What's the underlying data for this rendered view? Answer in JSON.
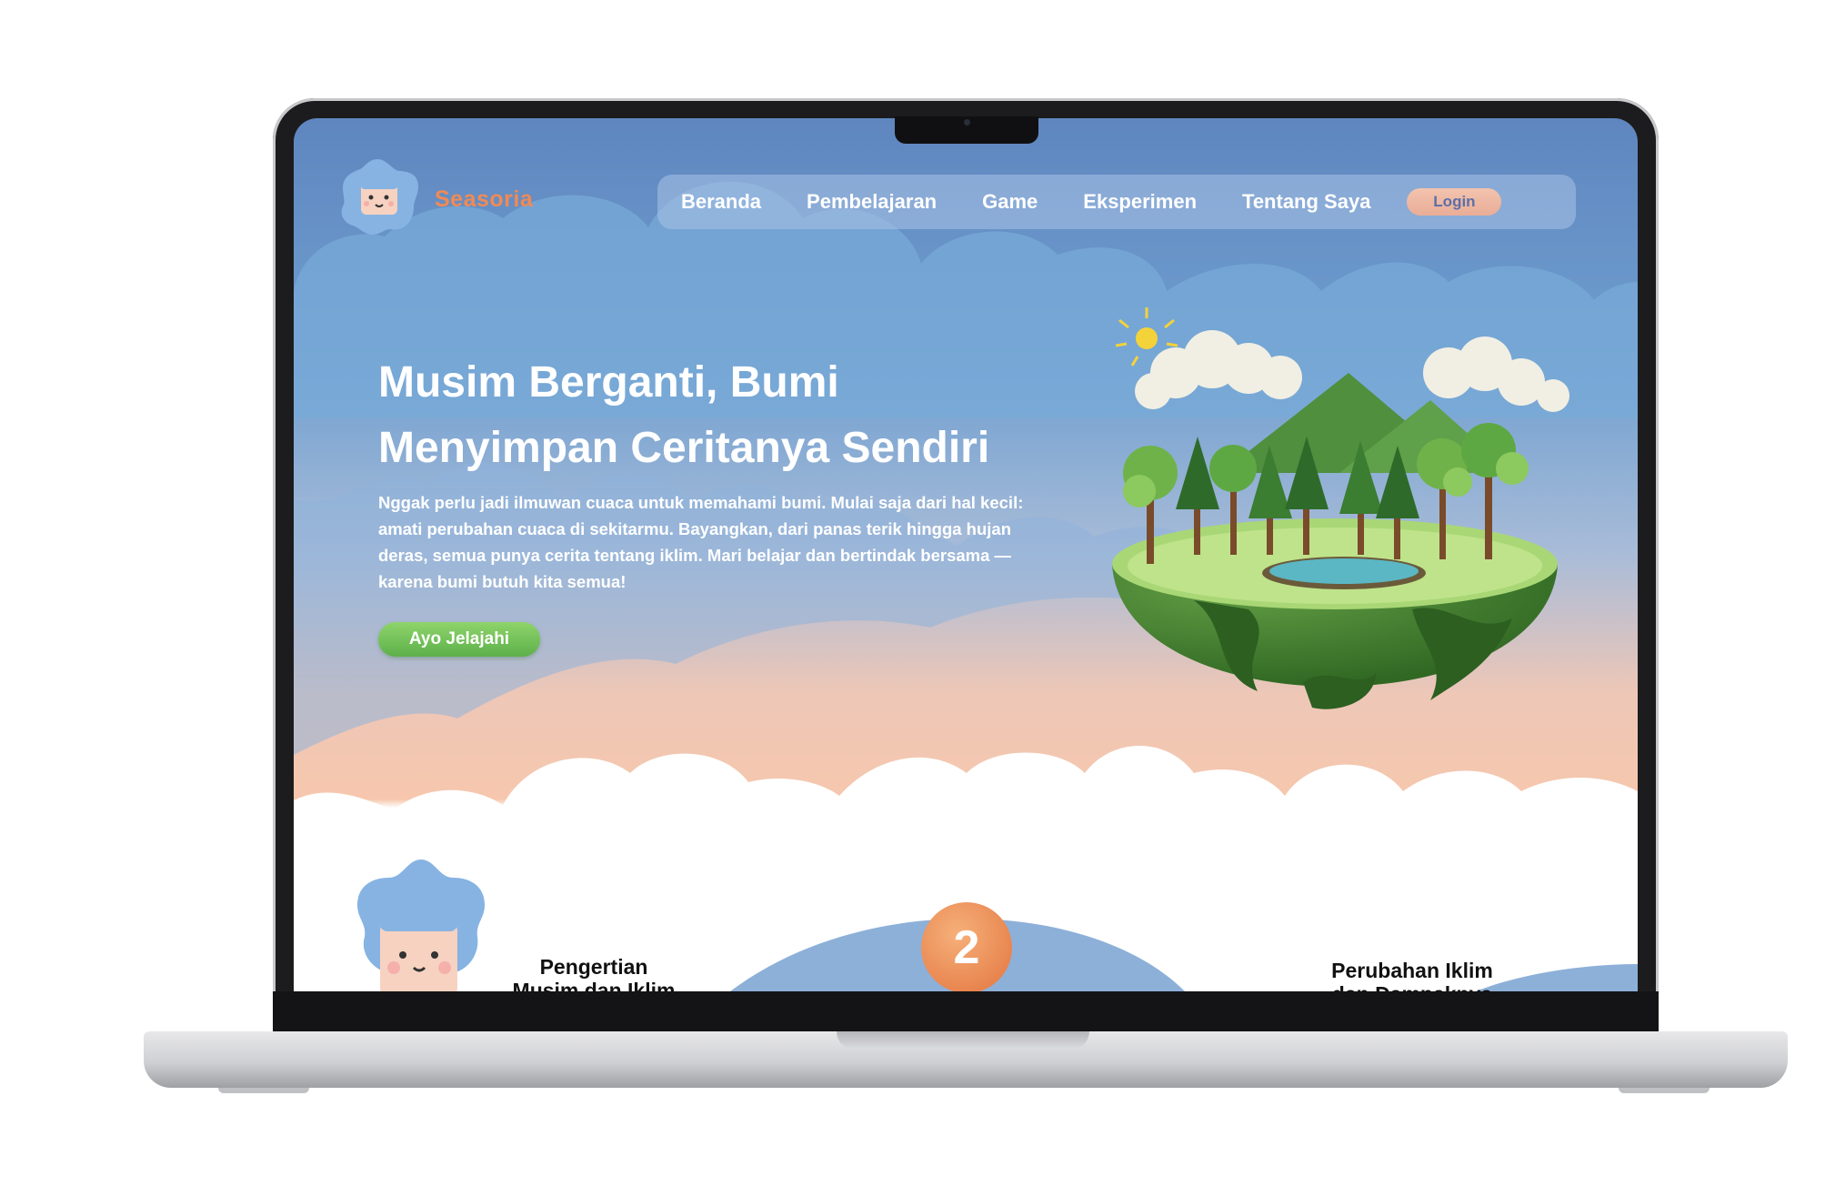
{
  "brand": {
    "name": "Seasoria"
  },
  "nav": {
    "items": [
      "Beranda",
      "Pembelajaran",
      "Game",
      "Eksperimen",
      "Tentang Saya"
    ],
    "login_label": "Login"
  },
  "hero": {
    "title_line1": "Musim Berganti, Bumi",
    "title_line2": "Menyimpan Ceritanya Sendiri",
    "text": "Nggak perlu jadi ilmuwan cuaca untuk memahami bumi. Mulai saja dari hal kecil: amati perubahan cuaca di sekitarmu. Bayangkan, dari panas terik hingga hujan deras, semua punya cerita tentang iklim. Mari belajar dan bertindak bersama — karena bumi butuh kita semua!",
    "cta_label": "Ayo Jelajahi"
  },
  "sections": {
    "badge_number": "2",
    "left_label_line1": "Pengertian",
    "left_label_line2": "Musim dan Iklim",
    "right_label_line1": "Perubahan Iklim",
    "right_label_line2": "dan Dampaknya"
  },
  "colors": {
    "accent": "#f08a55",
    "cta": "#6cbf52",
    "sky": "#6f9fd0"
  }
}
